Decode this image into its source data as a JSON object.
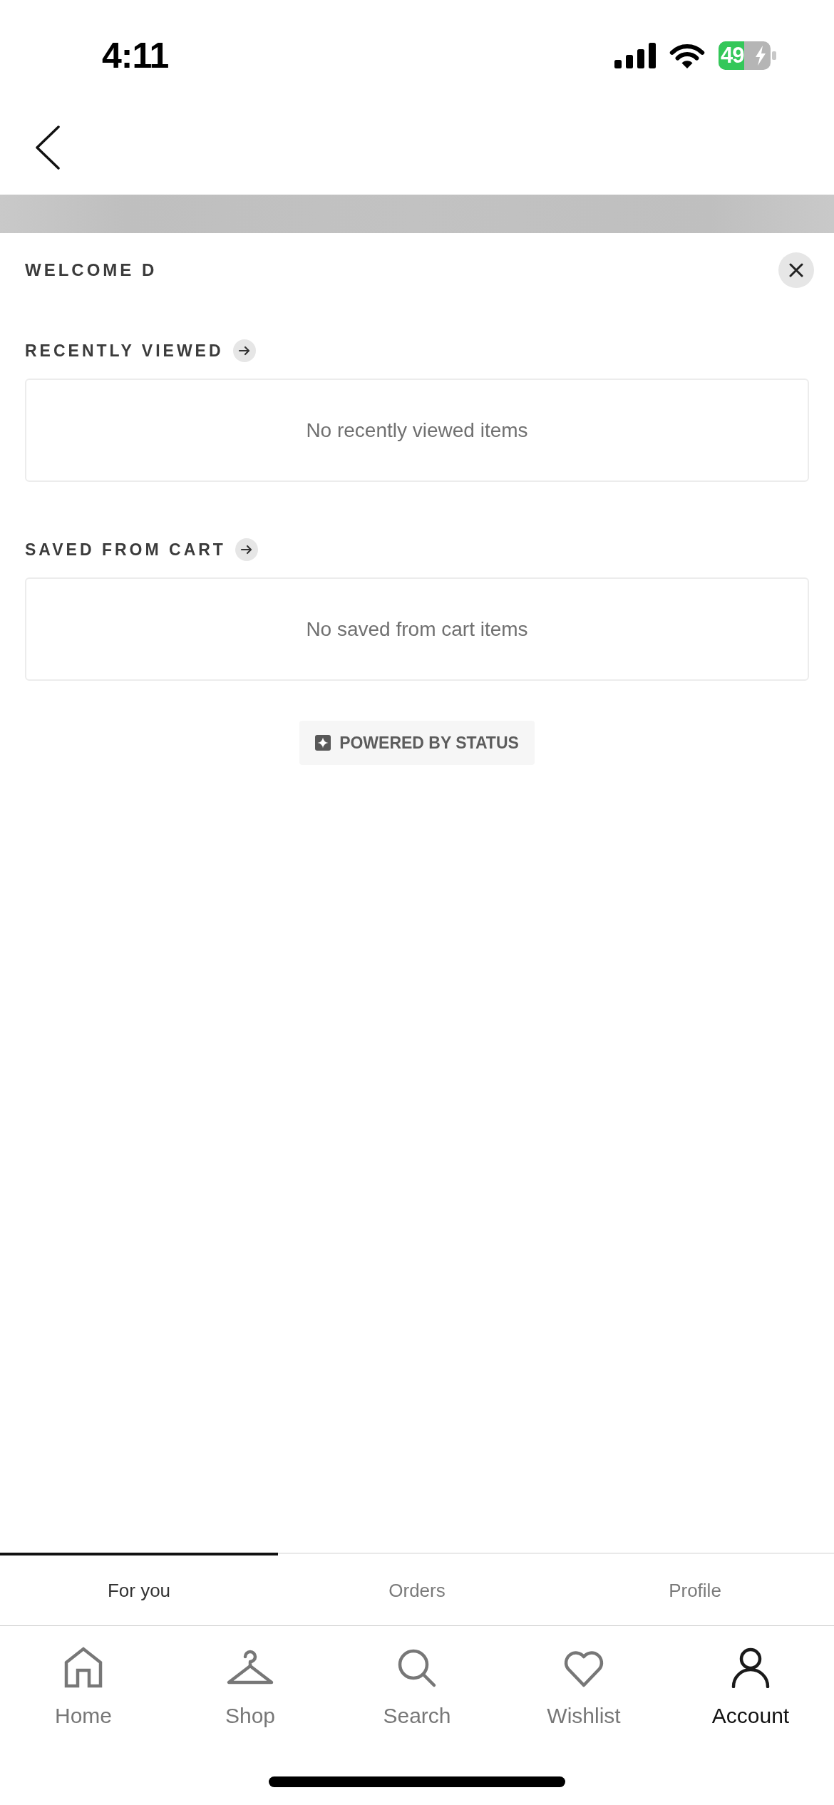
{
  "status_bar": {
    "time": "4:11",
    "battery_text": "49",
    "charging": true
  },
  "sheet": {
    "title": "WELCOME D",
    "sections": [
      {
        "title": "RECENTLY VIEWED",
        "empty_text": "No recently viewed items"
      },
      {
        "title": "SAVED FROM CART",
        "empty_text": "No saved from cart items"
      }
    ],
    "powered_by": "POWERED BY STATUS"
  },
  "tabs": [
    {
      "label": "For you",
      "selected": true
    },
    {
      "label": "Orders",
      "selected": false
    },
    {
      "label": "Profile",
      "selected": false
    }
  ],
  "bottom_nav": [
    {
      "kind": "home",
      "label": "Home",
      "selected": false
    },
    {
      "kind": "hanger",
      "label": "Shop",
      "selected": false
    },
    {
      "kind": "search",
      "label": "Search",
      "selected": false
    },
    {
      "kind": "heart",
      "label": "Wishlist",
      "selected": false
    },
    {
      "kind": "person",
      "label": "Account",
      "selected": true
    }
  ]
}
